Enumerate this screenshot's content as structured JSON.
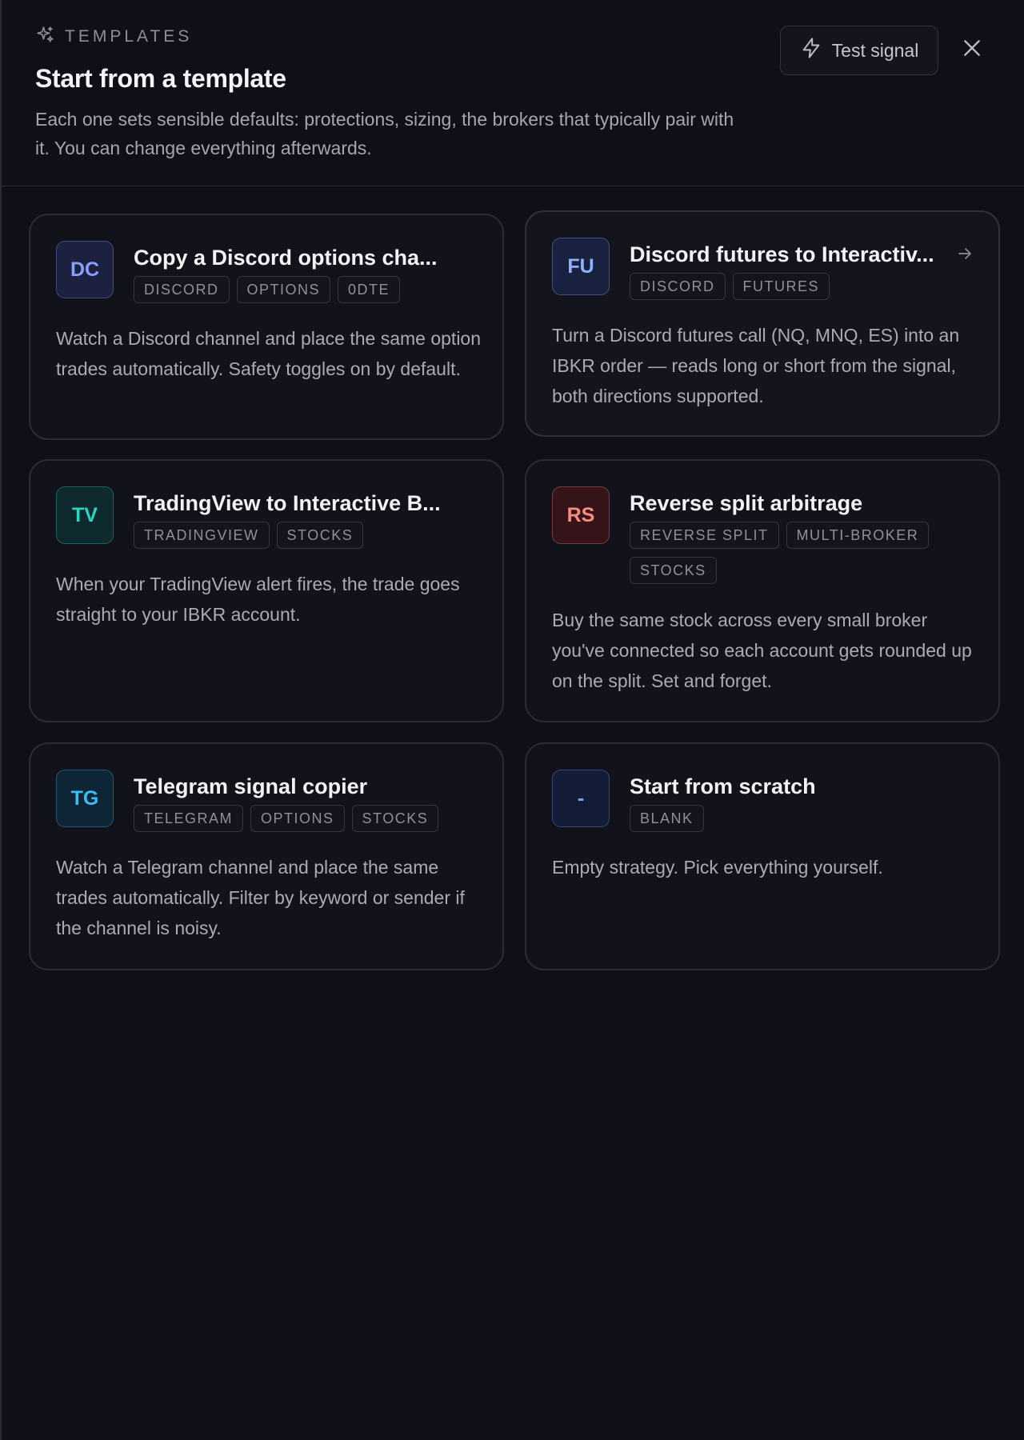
{
  "header": {
    "eyebrow": "TEMPLATES",
    "title": "Start from a template",
    "subtitle": "Each one sets sensible defaults: protections, sizing, the brokers that typically pair with it. You can change everything afterwards.",
    "test_signal_label": "Test signal",
    "icons": {
      "eyebrow": "sparkles-icon",
      "test_signal": "lightning-icon",
      "close": "close-icon"
    }
  },
  "templates": [
    {
      "initials": "DC",
      "title": "Copy a Discord options cha...",
      "tags": [
        "DISCORD",
        "OPTIONS",
        "0DTE"
      ],
      "description": "Watch a Discord channel and place the same option trades automatically. Safety toggles on by default.",
      "avatar_color": "#8aa0ff",
      "avatar_bg": "#1c2140"
    },
    {
      "initials": "FU",
      "title": "Discord futures to Interactiv...",
      "tags": [
        "DISCORD",
        "FUTURES"
      ],
      "description": "Turn a Discord futures call (NQ, MNQ, ES) into an IBKR order — reads long or short from the signal, both directions supported.",
      "avatar_color": "#8fb2ff",
      "avatar_bg": "#18223f",
      "hovered": true,
      "arrow_icon": "arrow-right-icon"
    },
    {
      "initials": "TV",
      "title": "TradingView to Interactive B...",
      "tags": [
        "TRADINGVIEW",
        "STOCKS"
      ],
      "description": "When your TradingView alert fires, the trade goes straight to your IBKR account.",
      "avatar_color": "#2dd4bf",
      "avatar_bg": "#0f2a2e"
    },
    {
      "initials": "RS",
      "title": "Reverse split arbitrage",
      "tags": [
        "REVERSE SPLIT",
        "MULTI-BROKER",
        "STOCKS"
      ],
      "description": "Buy the same stock across every small broker you've connected so each account gets rounded up on the split. Set and forget.",
      "avatar_color": "#fb8b80",
      "avatar_bg": "#341419"
    },
    {
      "initials": "TG",
      "title": "Telegram signal copier",
      "tags": [
        "TELEGRAM",
        "OPTIONS",
        "STOCKS"
      ],
      "description": "Watch a Telegram channel and place the same trades automatically. Filter by keyword or sender if the channel is noisy.",
      "avatar_color": "#38bdf8",
      "avatar_bg": "#0e2535"
    },
    {
      "initials": "-",
      "title": "Start from scratch",
      "tags": [
        "BLANK"
      ],
      "description": "Empty strategy. Pick everything yourself.",
      "avatar_color": "#7aa0f0",
      "avatar_bg": "#141d38"
    }
  ]
}
